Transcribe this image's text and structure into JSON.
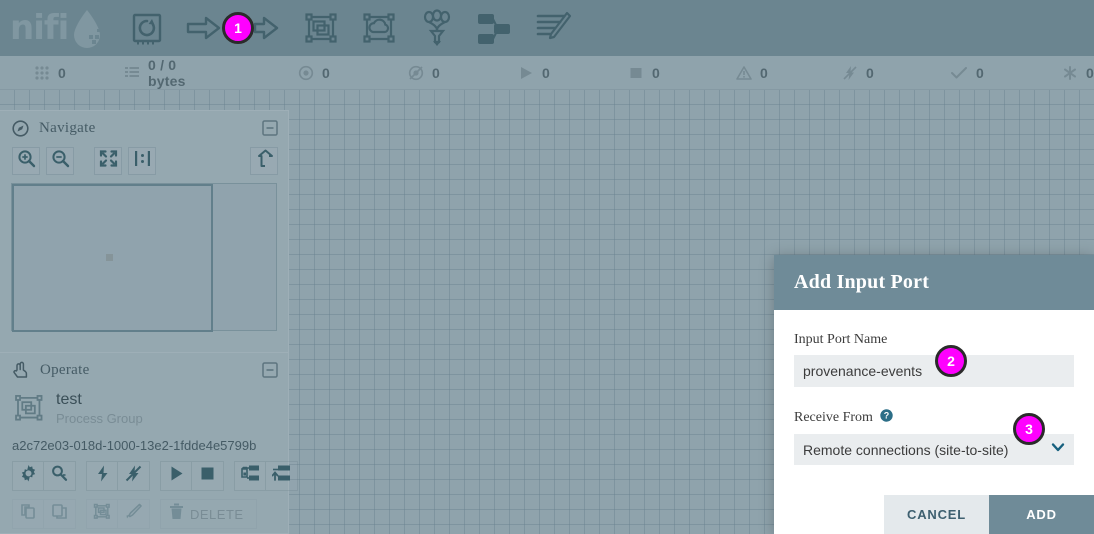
{
  "app": {
    "logo_text": "nifi",
    "logo_icon": "water-drop-icon"
  },
  "toolbar": {
    "items": [
      {
        "name": "processor-icon",
        "label": "Processor"
      },
      {
        "name": "input-port-icon",
        "label": "Input Port"
      },
      {
        "name": "output-port-icon",
        "label": "Output Port"
      },
      {
        "name": "process-group-icon",
        "label": "Process Group"
      },
      {
        "name": "remote-process-group-icon",
        "label": "Remote Process Group"
      },
      {
        "name": "funnel-icon",
        "label": "Funnel"
      },
      {
        "name": "template-icon",
        "label": "Template"
      },
      {
        "name": "label-icon",
        "label": "Label"
      }
    ]
  },
  "status_bar": {
    "items": [
      {
        "icon": "active-threads-icon",
        "value": "0"
      },
      {
        "icon": "queued-icon",
        "value": "0 / 0 bytes"
      },
      {
        "icon": "transmitting-icon",
        "value": "0"
      },
      {
        "icon": "not-transmitting-icon",
        "value": "0"
      },
      {
        "icon": "running-icon",
        "value": "0"
      },
      {
        "icon": "stopped-icon",
        "value": "0"
      },
      {
        "icon": "invalid-icon",
        "value": "0"
      },
      {
        "icon": "disabled-icon",
        "value": "0"
      },
      {
        "icon": "up-to-date-icon",
        "value": "0"
      },
      {
        "icon": "sync-failure-icon",
        "value": "0"
      }
    ]
  },
  "navigate_panel": {
    "title": "Navigate",
    "icon": "compass-icon",
    "collapse_icon": "minus-box-icon",
    "controls": [
      {
        "name": "zoom-in-button",
        "icon": "zoom-in-icon"
      },
      {
        "name": "zoom-out-button",
        "icon": "zoom-out-icon"
      },
      {
        "name": "zoom-fit-button",
        "icon": "fit-screen-icon"
      },
      {
        "name": "zoom-actual-size-button",
        "icon": "actual-size-icon"
      },
      {
        "name": "go-to-parent-button",
        "icon": "up-arrow-icon"
      }
    ]
  },
  "operate_panel": {
    "title": "Operate",
    "icon": "hand-pointer-icon",
    "collapse_icon": "minus-box-icon",
    "entity_icon": "process-group-icon",
    "entity_name": "test",
    "entity_type": "Process Group",
    "entity_id": "a2c72e03-018d-1000-13e2-1fdde4e5799b",
    "buttons_row1": [
      {
        "name": "configure-button",
        "icon": "gear-icon",
        "enabled": true
      },
      {
        "name": "view-details-button",
        "icon": "magnifier-icon",
        "enabled": true
      },
      {
        "name": "enable-button",
        "icon": "bolt-icon",
        "enabled": true
      },
      {
        "name": "disable-button",
        "icon": "bolt-slash-icon",
        "enabled": true
      },
      {
        "name": "start-button",
        "icon": "play-icon",
        "enabled": true
      },
      {
        "name": "stop-button",
        "icon": "stop-icon",
        "enabled": true
      },
      {
        "name": "create-template-button",
        "icon": "template-save-icon",
        "enabled": true
      },
      {
        "name": "upload-template-button",
        "icon": "template-upload-icon",
        "enabled": true
      }
    ],
    "buttons_row2": [
      {
        "name": "copy-button",
        "icon": "copy-icon",
        "enabled": false
      },
      {
        "name": "paste-button",
        "icon": "paste-icon",
        "enabled": false
      },
      {
        "name": "group-button",
        "icon": "group-icon",
        "enabled": false
      },
      {
        "name": "color-button",
        "icon": "paintbrush-icon",
        "enabled": false
      }
    ],
    "delete_button": {
      "name": "delete-button",
      "icon": "trash-icon",
      "label": "DELETE",
      "enabled": false
    }
  },
  "dialog": {
    "title": "Add Input Port",
    "fields": [
      {
        "label": "Input Port Name",
        "value": "provenance-events",
        "placeholder": "",
        "has_help": false
      },
      {
        "label": "Receive From",
        "value": "Remote connections (site-to-site)",
        "has_help": true,
        "help_icon": "question-circle-icon",
        "dropdown_icon": "chevron-down-icon"
      }
    ],
    "buttons": {
      "cancel": "CANCEL",
      "add": "ADD"
    }
  },
  "badges": [
    {
      "id": "badge-1",
      "label": "1"
    },
    {
      "id": "badge-2",
      "label": "2"
    },
    {
      "id": "badge-3",
      "label": "3"
    }
  ],
  "colors": {
    "toolbar_bg": "#7b939e",
    "statusbar_bg": "#a7b7c0",
    "canvas_bg": "#a7b7c0",
    "panel_bg": "#aebdc5",
    "dialog_header": "#6f8b98",
    "accent_badge": "#ff00ff",
    "icon_color": "#4a6873"
  }
}
